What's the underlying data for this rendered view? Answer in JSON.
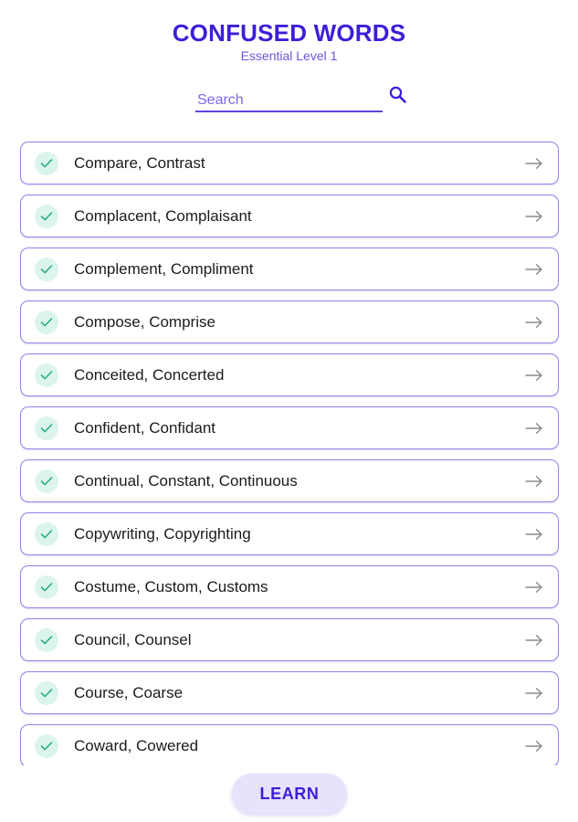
{
  "header": {
    "title": "CONFUSED WORDS",
    "subtitle": "Essential Level 1"
  },
  "search": {
    "placeholder": "Search",
    "value": "",
    "icon": "search-icon"
  },
  "list": {
    "status_icon": "check-icon",
    "action_icon": "arrow-right-icon",
    "items": [
      {
        "label": "Compare, Contrast",
        "done": true
      },
      {
        "label": "Complacent, Complaisant",
        "done": true
      },
      {
        "label": "Complement, Compliment",
        "done": true
      },
      {
        "label": "Compose, Comprise",
        "done": true
      },
      {
        "label": "Conceited, Concerted",
        "done": true
      },
      {
        "label": "Confident, Confidant",
        "done": true
      },
      {
        "label": "Continual, Constant, Continuous",
        "done": true
      },
      {
        "label": "Copywriting, Copyrighting",
        "done": true
      },
      {
        "label": "Costume, Custom, Customs",
        "done": true
      },
      {
        "label": "Council, Counsel",
        "done": true
      },
      {
        "label": "Course, Coarse",
        "done": true
      },
      {
        "label": "Coward, Cowered",
        "done": true
      }
    ]
  },
  "footer": {
    "learn_label": "LEARN"
  },
  "colors": {
    "accent": "#3a1fd8",
    "border": "#8f84e8",
    "check_bg": "#dcf5ec",
    "check_mark": "#2bb07f",
    "button_bg": "#e8e2fc"
  }
}
